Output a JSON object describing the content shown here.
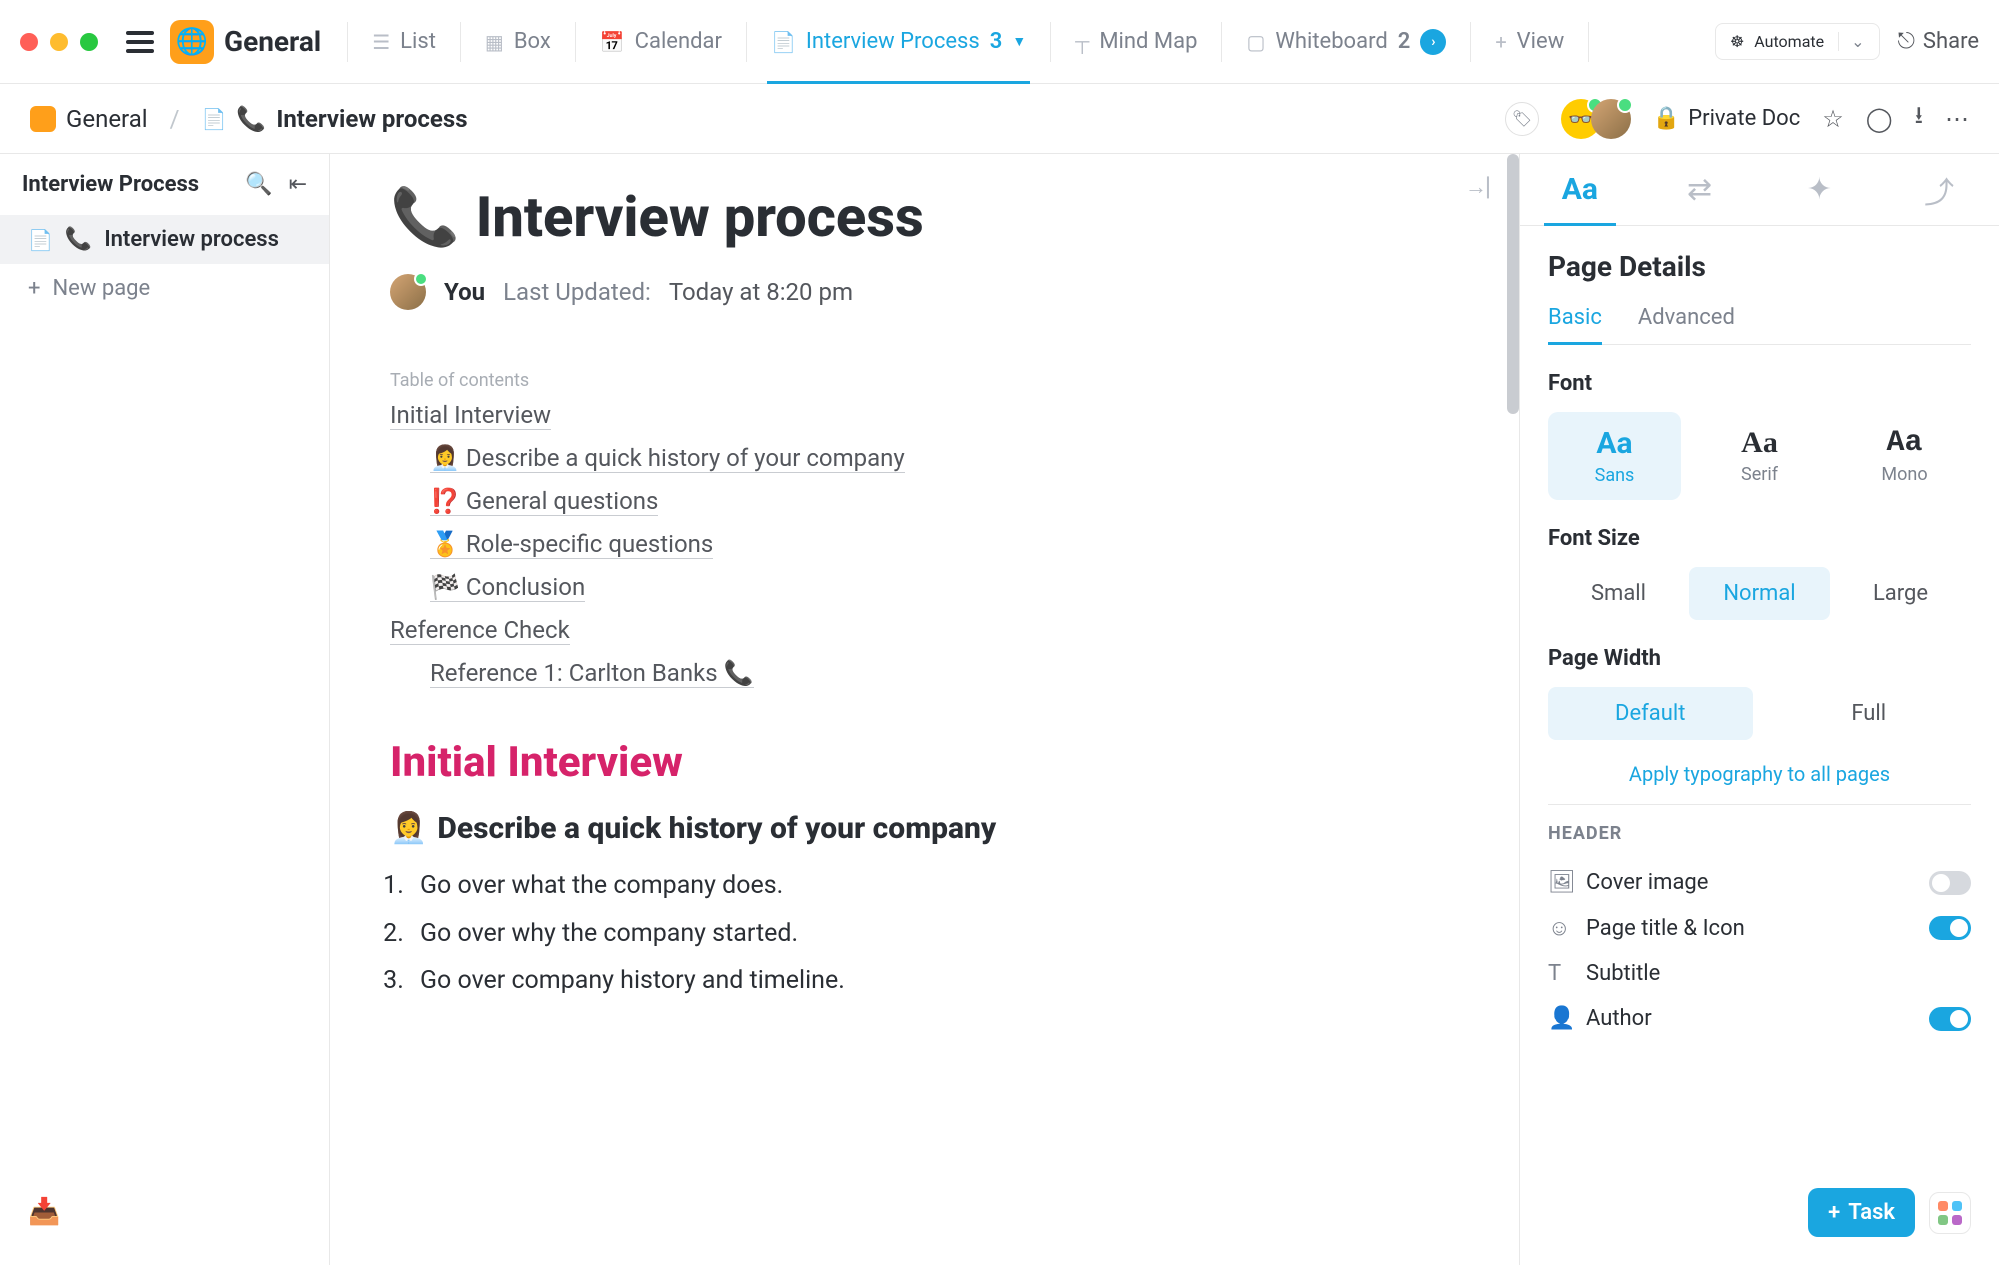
{
  "workspace": {
    "name": "General"
  },
  "views": {
    "list": "List",
    "box": "Box",
    "calendar": "Calendar",
    "interview": {
      "label": "Interview Process",
      "count": "3"
    },
    "mindmap": "Mind Map",
    "whiteboard": {
      "label": "Whiteboard",
      "count": "2"
    },
    "add_view": "View"
  },
  "toolbar": {
    "automate": "Automate",
    "share": "Share"
  },
  "breadcrumb": {
    "root": "General",
    "page_icon": "📞",
    "page": "Interview process"
  },
  "privacy": {
    "label": "Private Doc"
  },
  "left_panel": {
    "title": "Interview Process",
    "items": [
      {
        "icon": "📞",
        "label": "Interview process"
      }
    ],
    "new_page": "New page"
  },
  "document": {
    "icon": "📞",
    "title": "Interview process",
    "author": "You",
    "last_updated_label": "Last Updated:",
    "last_updated_value": "Today at 8:20 pm",
    "toc_label": "Table of contents",
    "toc": [
      {
        "level": 1,
        "text": "Initial Interview"
      },
      {
        "level": 2,
        "text": "👩‍💼 Describe a quick history of your company"
      },
      {
        "level": 2,
        "text": "⁉️ General questions"
      },
      {
        "level": 2,
        "text": "🏅 Role-specific questions"
      },
      {
        "level": 2,
        "text": "🏁 Conclusion"
      },
      {
        "level": 1,
        "text": "Reference Check"
      },
      {
        "level": 2,
        "text": "Reference 1: Carlton Banks 📞"
      }
    ],
    "h1": "Initial Interview",
    "h2_icon": "👩‍💼",
    "h2": "Describe a quick history of your company",
    "list": [
      "Go over what the company does.",
      "Go over why the company started.",
      "Go over company history and timeline."
    ]
  },
  "right_panel": {
    "title": "Page Details",
    "tabs": {
      "basic": "Basic",
      "advanced": "Advanced"
    },
    "font": {
      "label": "Font",
      "options": {
        "sans": "Sans",
        "serif": "Serif",
        "mono": "Mono"
      }
    },
    "font_size": {
      "label": "Font Size",
      "options": {
        "small": "Small",
        "normal": "Normal",
        "large": "Large"
      }
    },
    "page_width": {
      "label": "Page Width",
      "options": {
        "default": "Default",
        "full": "Full"
      }
    },
    "apply_all": "Apply typography to all pages",
    "header_section": "HEADER",
    "toggles": {
      "cover": "Cover image",
      "title_icon": "Page title & Icon",
      "subtitle": "Subtitle",
      "author": "Author"
    }
  },
  "fab": {
    "task": "Task"
  }
}
